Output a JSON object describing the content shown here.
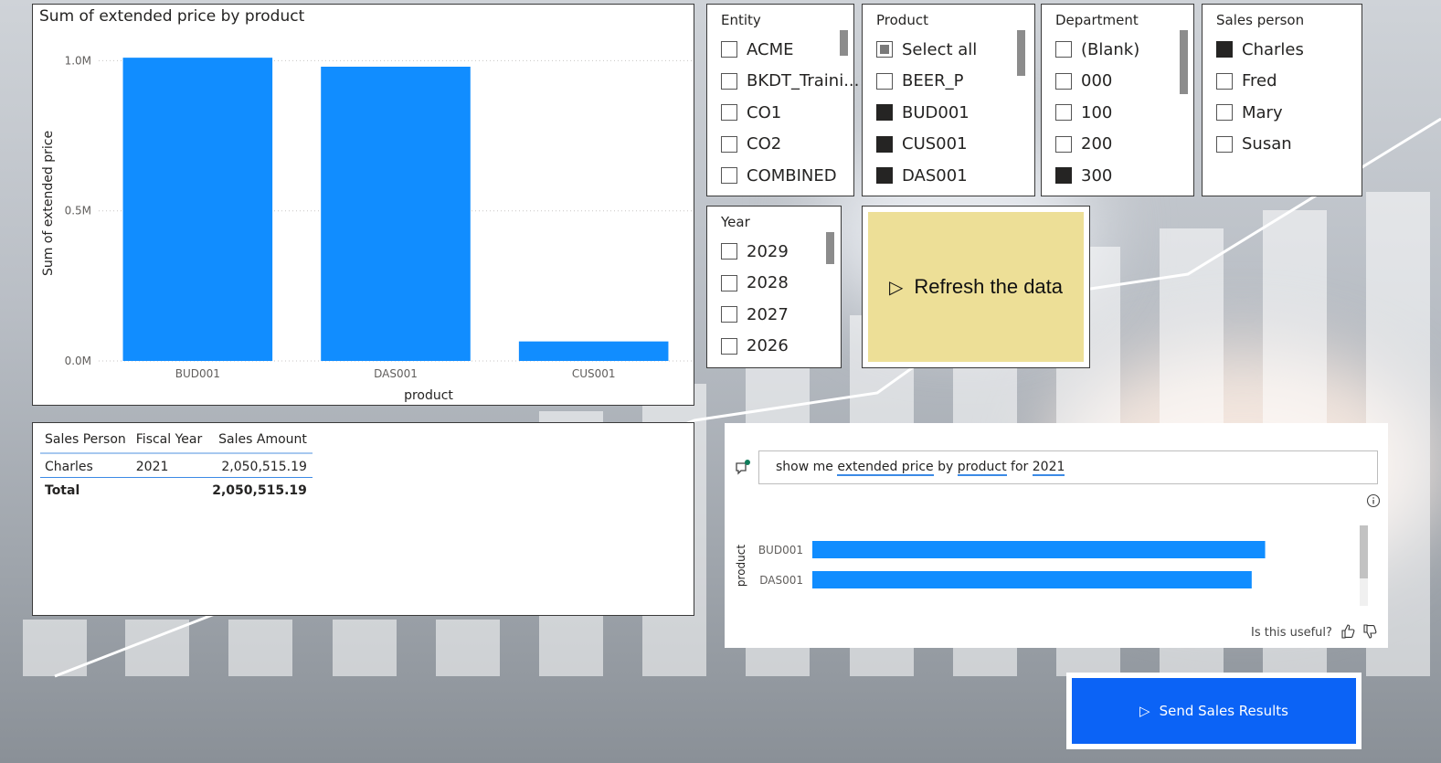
{
  "main_chart": {
    "title": "Sum of extended price by product",
    "chart_data": {
      "type": "bar",
      "title": "Sum of extended price by product",
      "xlabel": "product",
      "ylabel": "Sum of extended price",
      "categories": [
        "BUD001",
        "DAS001",
        "CUS001"
      ],
      "values": [
        1010000,
        980000,
        65000
      ],
      "ylim": [
        0,
        1050000
      ],
      "yticks": [
        "0.0M",
        "0.5M",
        "1.0M"
      ],
      "ytick_values": [
        0,
        500000,
        1000000
      ],
      "grid": true,
      "color": "#118DFF"
    }
  },
  "table": {
    "headers": [
      "Sales Person",
      "Fiscal Year",
      "Sales Amount"
    ],
    "row": {
      "sales_person": "Charles",
      "fiscal_year": "2021",
      "sales_amount": "2,050,515.19"
    },
    "total": {
      "label": "Total",
      "sales_amount": "2,050,515.19"
    }
  },
  "slicers": {
    "entity": {
      "title": "Entity",
      "items": [
        "ACME",
        "BKDT_Traini...",
        "CO1",
        "CO2",
        "COMBINED"
      ]
    },
    "product": {
      "title": "Product",
      "items": [
        "Select all",
        "BEER_P",
        "BUD001",
        "CUS001",
        "DAS001"
      ]
    },
    "department": {
      "title": "Department",
      "items": [
        "(Blank)",
        "000",
        "100",
        "200",
        "300"
      ]
    },
    "sales_person": {
      "title": "Sales person",
      "items": [
        "Charles",
        "Fred",
        "Mary",
        "Susan"
      ]
    },
    "year": {
      "title": "Year",
      "items": [
        "2029",
        "2028",
        "2027",
        "2026"
      ]
    }
  },
  "refresh_button": {
    "label": "Refresh the data"
  },
  "qa": {
    "query_parts": [
      "show me ",
      "extended price",
      " by ",
      "product",
      " for ",
      "2021"
    ],
    "useful_label": "Is this useful?",
    "chart_data": {
      "type": "bar",
      "orientation": "horizontal",
      "ylabel": "product",
      "categories": [
        "BUD001",
        "DAS001"
      ],
      "values": [
        1010000,
        980000
      ],
      "color": "#118DFF"
    }
  },
  "send_button": {
    "label": "Send Sales Results"
  },
  "colors": {
    "accent": "#118DFF",
    "button_blue": "#0B63F6",
    "refresh_yellow": "#EDDF97"
  }
}
